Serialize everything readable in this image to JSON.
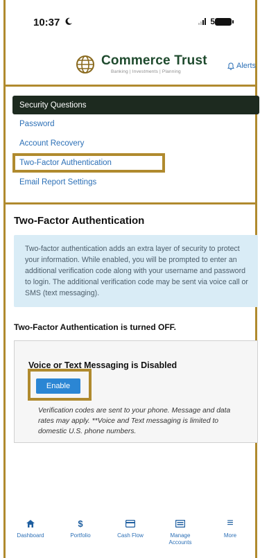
{
  "status_bar": {
    "time": "10:37",
    "network": "5G"
  },
  "header": {
    "brand": "Commerce Trust",
    "tagline": "Banking | Investments | Planning",
    "alerts_label": "Alerts"
  },
  "menu": {
    "items": [
      {
        "label": "Security Questions"
      },
      {
        "label": "Password"
      },
      {
        "label": "Account Recovery"
      },
      {
        "label": "Two-Factor Authentication"
      },
      {
        "label": "Email Report Settings"
      }
    ]
  },
  "main": {
    "title": "Two-Factor Authentication",
    "info_text": "Two-factor authentication adds an extra layer of security to protect your information. While enabled, you will be prompted to enter an additional verification code along with your username and password to login. The additional verification code may be sent via voice call or SMS (text messaging).",
    "status_text": "Two-Factor Authentication is turned OFF.",
    "card": {
      "title": "Voice or Text Messaging is Disabled",
      "enable_label": "Enable",
      "note": "Verification codes are sent to your phone. Message and data rates may apply. **Voice and Text messaging is limited to domestic U.S. phone numbers."
    }
  },
  "bottom_nav": {
    "items": [
      {
        "label": "Dashboard",
        "icon": "home-icon",
        "glyph": "⌂"
      },
      {
        "label": "Portfolio",
        "icon": "dollar-icon",
        "glyph": "$"
      },
      {
        "label": "Cash Flow",
        "icon": "card-icon",
        "glyph": ""
      },
      {
        "label": "Manage Accounts",
        "icon": "accounts-icon",
        "glyph": ""
      },
      {
        "label": "More",
        "icon": "menu-icon",
        "glyph": "≡"
      }
    ]
  },
  "colors": {
    "gold_frame": "#b08a2e",
    "brand_green": "#1e4a2d",
    "link_blue": "#2b6fb6",
    "active_menu_bg": "#1d2a1f",
    "info_bg": "#d9ecf6",
    "button_blue": "#2b86d4"
  }
}
